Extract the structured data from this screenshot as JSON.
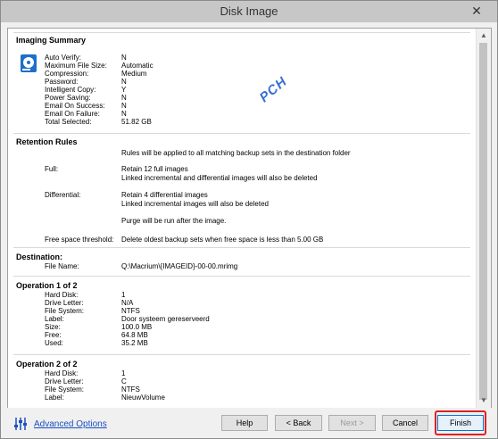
{
  "window": {
    "title": "Disk Image",
    "close_glyph": "✕"
  },
  "summary": {
    "header": "Imaging Summary",
    "watermark": "PCH",
    "rows": [
      {
        "label": "Auto Verify:",
        "value": "N"
      },
      {
        "label": "Maximum File Size:",
        "value": "Automatic"
      },
      {
        "label": "Compression:",
        "value": "Medium"
      },
      {
        "label": "Password:",
        "value": "N"
      },
      {
        "label": "Intelligent Copy:",
        "value": "Y"
      },
      {
        "label": "Power Saving:",
        "value": "N"
      },
      {
        "label": "Email On Success:",
        "value": "N"
      },
      {
        "label": "Email On Failure:",
        "value": "N"
      },
      {
        "label": "Total Selected:",
        "value": "51.82 GB"
      }
    ]
  },
  "retention": {
    "header": "Retention Rules",
    "intro": "Rules will be applied to all matching backup sets in the destination folder",
    "full_label": "Full:",
    "full_line1": "Retain 12 full images",
    "full_line2": "Linked incremental and differential images will also be deleted",
    "diff_label": "Differential:",
    "diff_line1": "Retain 4 differential images",
    "diff_line2": "Linked incremental images will also be deleted",
    "purge": "Purge will be run after the image.",
    "free_label": "Free space threshold:",
    "free_value": "Delete oldest backup sets when free space is less than 5.00 GB"
  },
  "destination": {
    "header": "Destination:",
    "file_label": "File Name:",
    "file_value": "Q:\\Macrium\\{IMAGEID}-00-00.mrimg"
  },
  "operation1": {
    "header": "Operation 1 of 2",
    "rows": [
      {
        "label": "Hard Disk:",
        "value": "1"
      },
      {
        "label": "Drive Letter:",
        "value": "N/A"
      },
      {
        "label": "File System:",
        "value": "NTFS"
      },
      {
        "label": "Label:",
        "value": "Door systeem gereserveerd"
      },
      {
        "label": "Size:",
        "value": "100.0 MB"
      },
      {
        "label": "Free:",
        "value": "64.8 MB"
      },
      {
        "label": "Used:",
        "value": "35.2 MB"
      }
    ]
  },
  "operation2": {
    "header": "Operation 2 of 2",
    "rows": [
      {
        "label": "Hard Disk:",
        "value": "1"
      },
      {
        "label": "Drive Letter:",
        "value": "C"
      },
      {
        "label": "File System:",
        "value": "NTFS"
      },
      {
        "label": "Label:",
        "value": "NieuwVolume"
      }
    ]
  },
  "footer": {
    "advanced_options": "Advanced Options",
    "help": "Help",
    "back": "< Back",
    "next": "Next >",
    "cancel": "Cancel",
    "finish": "Finish"
  }
}
